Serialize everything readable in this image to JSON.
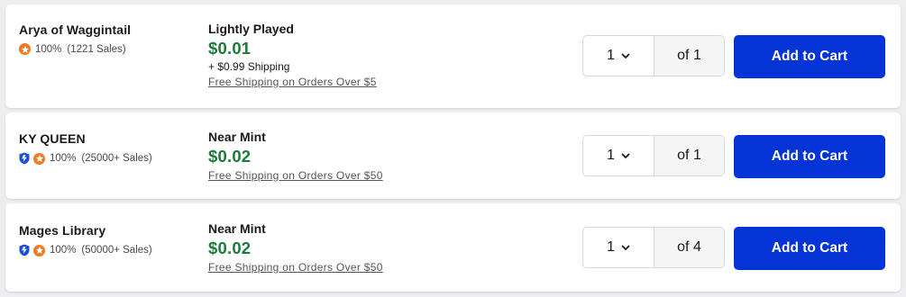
{
  "listings": [
    {
      "seller": "Arya of Waggintail",
      "verified_badge": false,
      "rating_icon": "star-icon",
      "rating_pct": "100%",
      "sales": "(1221 Sales)",
      "condition": "Lightly Played",
      "price": "$0.01",
      "shipping": "+ $0.99 Shipping",
      "free_shipping": "Free Shipping on Orders Over $5",
      "qty": "1",
      "of_qty": "of 1",
      "button": "Add to Cart"
    },
    {
      "seller": "KY QUEEN",
      "verified_badge": true,
      "rating_icon": "star-icon",
      "rating_pct": "100%",
      "sales": "(25000+ Sales)",
      "condition": "Near Mint",
      "price": "$0.02",
      "shipping": "",
      "free_shipping": "Free Shipping on Orders Over $50",
      "qty": "1",
      "of_qty": "of 1",
      "button": "Add to Cart"
    },
    {
      "seller": "Mages Library",
      "verified_badge": true,
      "rating_icon": "star-icon",
      "rating_pct": "100%",
      "sales": "(50000+ Sales)",
      "condition": "Near Mint",
      "price": "$0.02",
      "shipping": "",
      "free_shipping": "Free Shipping on Orders Over $50",
      "qty": "1",
      "of_qty": "of 4",
      "button": "Add to Cart"
    }
  ],
  "colors": {
    "price_green": "#1d7a3a",
    "button_blue": "#0433d6",
    "star_orange": "#f07a24",
    "badge_blue": "#1c4fd8"
  }
}
